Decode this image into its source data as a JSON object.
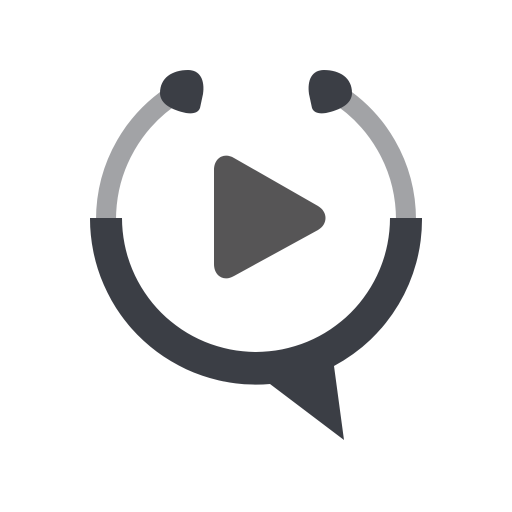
{
  "icon": {
    "name": "stethoscope-play-icon",
    "colors": {
      "background": "#ffffff",
      "dark": "#3b3e45",
      "tube": "#a2a3a6",
      "play": "#565556"
    }
  }
}
